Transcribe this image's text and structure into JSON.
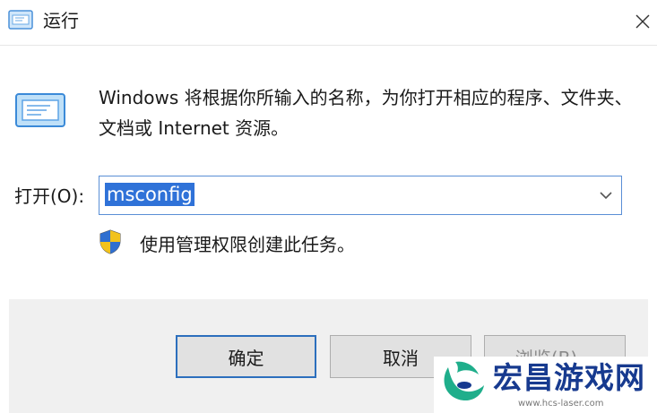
{
  "window": {
    "title": "运行",
    "title_icon": "run-dialog-icon",
    "close_icon": "close-icon"
  },
  "content": {
    "app_icon": "run-dialog-icon",
    "description": "Windows 将根据你所输入的名称，为你打开相应的程序、文件夹、文档或 Internet 资源。"
  },
  "open_field": {
    "label": "打开(O):",
    "value": "msconfig",
    "dropdown_icon": "chevron-down-icon"
  },
  "admin_note": {
    "icon": "uac-shield-icon",
    "text": "使用管理权限创建此任务。"
  },
  "buttons": {
    "ok": "确定",
    "cancel": "取消",
    "browse": "浏览(B)..."
  },
  "watermark": {
    "title": "宏昌游戏网",
    "url": "www.hcs-laser.com"
  },
  "colors": {
    "selection": "#2f72d8",
    "focus_border": "#2c6fbd",
    "footer_bg": "#f0f0f0",
    "watermark_text": "#173a8f"
  }
}
